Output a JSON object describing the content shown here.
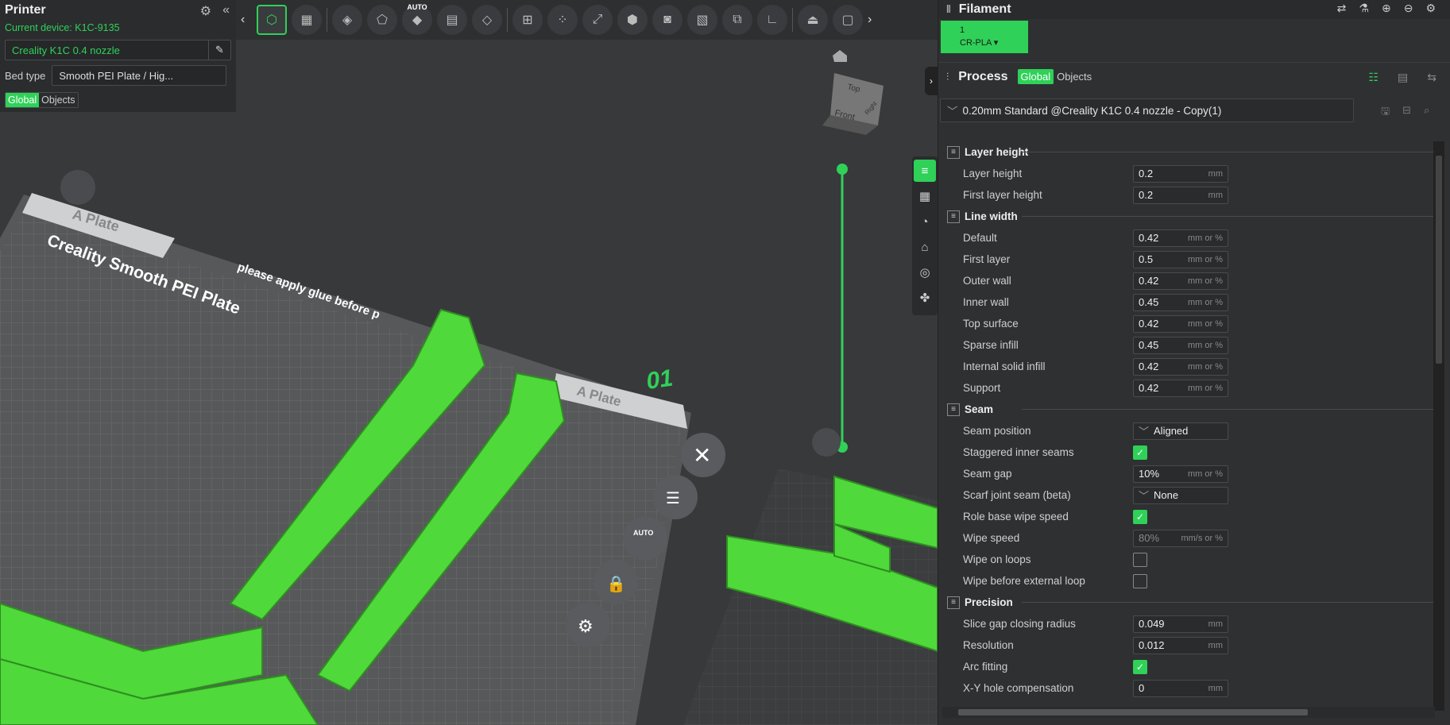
{
  "printer": {
    "title": "Printer",
    "device": "Current device: K1C-9135",
    "nozzle": "Creality K1C 0.4 nozzle",
    "bed_label": "Bed type",
    "bed_value": "Smooth PEI Plate / Hig...",
    "seg_global": "Global",
    "seg_objects": "Objects"
  },
  "toolbar": {
    "auto": "AUTO"
  },
  "scene": {
    "plate_name": "A Plate",
    "plate_brand": "Creality Smooth PEI Plate",
    "plate_note": "please apply glue before p",
    "plate_number": "01",
    "plate_name2": "A Plate",
    "cube_top": "Top",
    "cube_front": "Front",
    "cube_right": "Right",
    "auto_btn": "AUTO"
  },
  "filament": {
    "title": "Filament",
    "slot": "1",
    "material": "CR-PLA"
  },
  "process": {
    "title": "Process",
    "seg_global": "Global",
    "seg_objects": "Objects",
    "preset": "0.20mm Standard @Creality K1C 0.4 nozzle - Copy(1)"
  },
  "groups": [
    {
      "title": "Layer height",
      "rows": [
        {
          "label": "Layer height",
          "type": "field",
          "value": "0.2",
          "unit": "mm"
        },
        {
          "label": "First layer height",
          "type": "field",
          "value": "0.2",
          "unit": "mm"
        }
      ]
    },
    {
      "title": "Line width",
      "rows": [
        {
          "label": "Default",
          "type": "field",
          "value": "0.42",
          "unit": "mm or %"
        },
        {
          "label": "First layer",
          "type": "field",
          "value": "0.5",
          "unit": "mm or %"
        },
        {
          "label": "Outer wall",
          "type": "field",
          "value": "0.42",
          "unit": "mm or %"
        },
        {
          "label": "Inner wall",
          "type": "field",
          "value": "0.45",
          "unit": "mm or %"
        },
        {
          "label": "Top surface",
          "type": "field",
          "value": "0.42",
          "unit": "mm or %"
        },
        {
          "label": "Sparse infill",
          "type": "field",
          "value": "0.45",
          "unit": "mm or %"
        },
        {
          "label": "Internal solid infill",
          "type": "field",
          "value": "0.42",
          "unit": "mm or %"
        },
        {
          "label": "Support",
          "type": "field",
          "value": "0.42",
          "unit": "mm or %"
        }
      ]
    },
    {
      "title": "Seam",
      "rows": [
        {
          "label": "Seam position",
          "type": "dropdown",
          "value": "Aligned"
        },
        {
          "label": "Staggered inner seams",
          "type": "check",
          "checked": true
        },
        {
          "label": "Seam gap",
          "type": "field",
          "value": "10%",
          "unit": "mm or %"
        },
        {
          "label": "Scarf joint seam (beta)",
          "type": "dropdown",
          "value": "None"
        },
        {
          "label": "Role base wipe speed",
          "type": "check",
          "checked": true
        },
        {
          "label": "Wipe speed",
          "type": "field",
          "value": "80%",
          "unit": "mm/s or %",
          "disabled": true
        },
        {
          "label": "Wipe on loops",
          "type": "check",
          "checked": false
        },
        {
          "label": "Wipe before external loop",
          "type": "check",
          "checked": false
        }
      ]
    },
    {
      "title": "Precision",
      "rows": [
        {
          "label": "Slice gap closing radius",
          "type": "field",
          "value": "0.049",
          "unit": "mm"
        },
        {
          "label": "Resolution",
          "type": "field",
          "value": "0.012",
          "unit": "mm"
        },
        {
          "label": "Arc fitting",
          "type": "check",
          "checked": true
        },
        {
          "label": "X-Y hole compensation",
          "type": "field",
          "value": "0",
          "unit": "mm"
        }
      ]
    }
  ],
  "colors": {
    "accent": "#2fd158",
    "panel": "#2f3032",
    "viewport": "#38393b",
    "model": "#4fd93a"
  }
}
